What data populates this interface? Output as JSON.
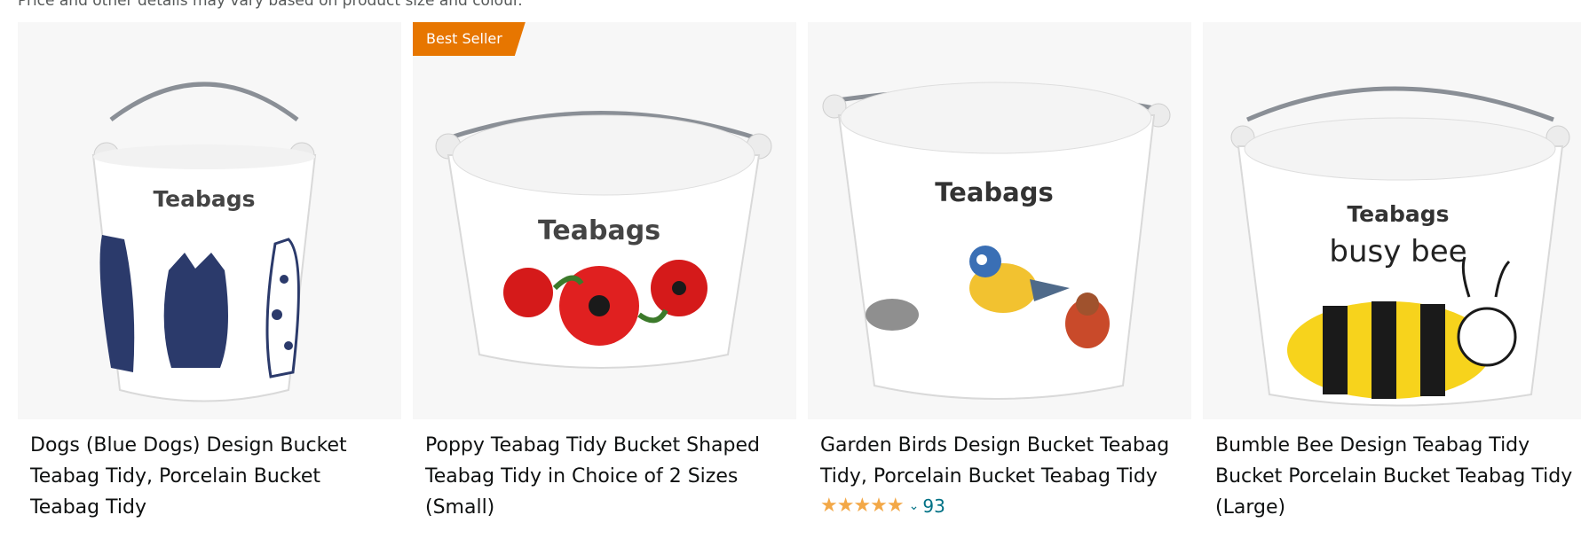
{
  "disclaimer": "Price and other details may vary based on product size and colour.",
  "accent_badge_color": "#e77600",
  "star_color": "#f3a847",
  "link_color": "#007185",
  "products": [
    {
      "title": "Dogs (Blue Dogs) Design Bucket Teabag Tidy, Porcelain Bucket Teabag Tidy",
      "image_label": "Teabags"
    },
    {
      "badge": "Best Seller",
      "title": "Poppy Teabag Tidy Bucket Shaped Teabag Tidy in Choice of 2 Sizes (Small)",
      "image_label": "Teabags"
    },
    {
      "title": "Garden Birds Design Bucket Teabag Tidy, Porcelain Bucket Teabag Tidy",
      "image_label": "Teabags",
      "rating_stars": "★★★★★",
      "rating_value": 5,
      "review_count": "93"
    },
    {
      "title": "Bumble Bee Design Teabag Tidy Bucket Porcelain Bucket Teabag Tidy (Large)",
      "image_label": "Teabags",
      "image_slogan": "busy bee"
    }
  ]
}
